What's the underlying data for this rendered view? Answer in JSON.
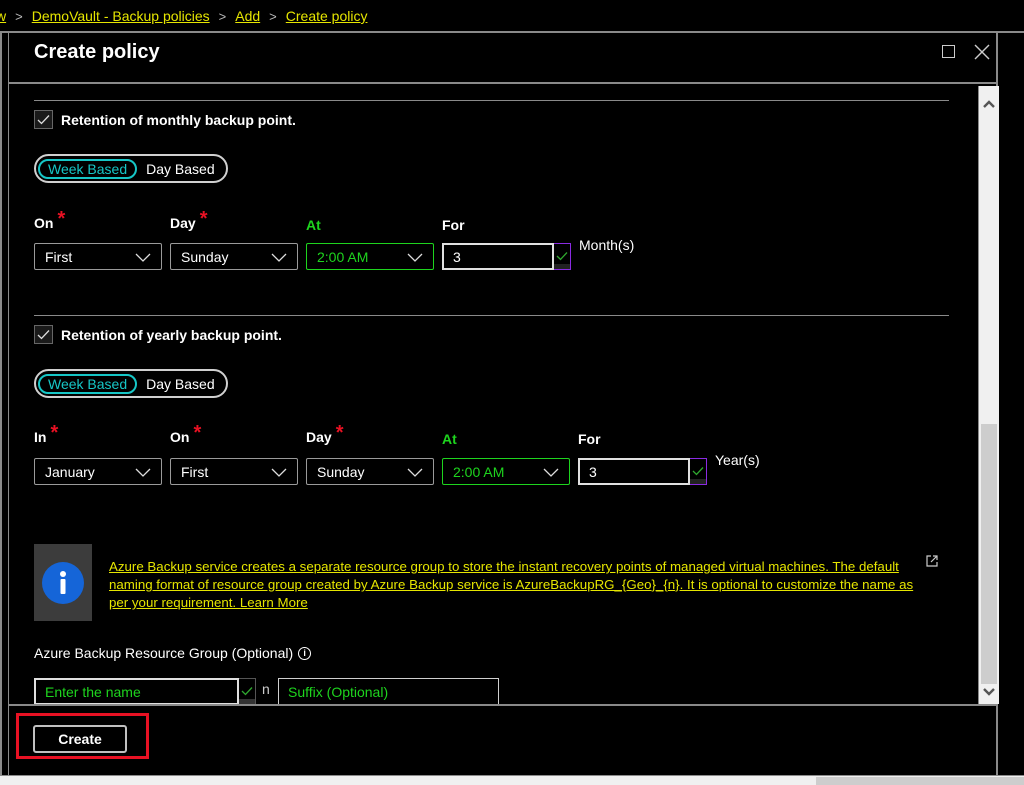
{
  "breadcrumb": {
    "items": [
      "w",
      "DemoVault - Backup policies",
      "Add",
      "Create policy"
    ],
    "separator": ">"
  },
  "blade": {
    "title": "Create policy",
    "maximize_icon": "maximize-icon",
    "close_icon": "close-icon"
  },
  "monthly": {
    "checkbox_label": "Retention of monthly backup point.",
    "checked": true,
    "toggle": {
      "options": [
        "Week Based",
        "Day Based"
      ],
      "selected": "Week Based"
    },
    "fields": {
      "on": {
        "label": "On",
        "required": "*",
        "value": "First"
      },
      "day": {
        "label": "Day",
        "required": "*",
        "value": "Sunday"
      },
      "at": {
        "label": "At",
        "value": "2:00 AM"
      },
      "for": {
        "label": "For",
        "value": "3",
        "unit": "Month(s)"
      }
    }
  },
  "yearly": {
    "checkbox_label": "Retention of yearly backup point.",
    "checked": true,
    "toggle": {
      "options": [
        "Week Based",
        "Day Based"
      ],
      "selected": "Week Based"
    },
    "fields": {
      "in": {
        "label": "In",
        "required": "*",
        "value": "January"
      },
      "on": {
        "label": "On",
        "required": "*",
        "value": "First"
      },
      "day": {
        "label": "Day",
        "required": "*",
        "value": "Sunday"
      },
      "at": {
        "label": "At",
        "value": "2:00 AM"
      },
      "for": {
        "label": "For",
        "value": "3",
        "unit": "Year(s)"
      }
    }
  },
  "info": {
    "text": "Azure Backup service creates a separate resource group to store the instant recovery points of managed virtual machines. The default naming format of resource group created by Azure Backup service is AzureBackupRG_{Geo}_{n}. It is optional to customize the name as per your requirement. Learn More",
    "icon": "info-icon",
    "external_icon": "external-link-icon"
  },
  "resource_group": {
    "label": "Azure Backup Resource Group (Optional)",
    "name_placeholder": "Enter the name",
    "separator": "n",
    "suffix_placeholder": "Suffix (Optional)"
  },
  "footer": {
    "create_label": "Create"
  },
  "colors": {
    "accent_cyan": "#16c6c6",
    "link_yellow": "#e6e600",
    "valid_green": "#1ed41e",
    "required_red": "#e81123",
    "info_blue": "#1565d8"
  }
}
